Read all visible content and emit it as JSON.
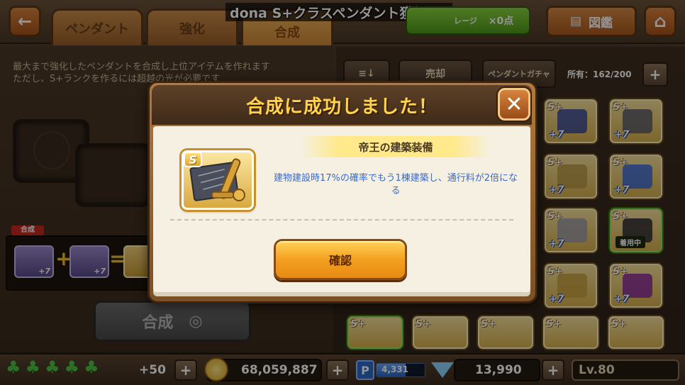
{
  "top_bar": {
    "back_icon": "back-arrow-icon",
    "tabs": [
      {
        "label": "ペンダント"
      },
      {
        "label": "強化"
      },
      {
        "label": "合成"
      }
    ],
    "ticker_text": "dona S+クラスペンダント獲得おめ",
    "points_label_fragment": "レージ",
    "points_value": "×0点",
    "zukan_label": "図鑑",
    "zukan_icon": "book-icon",
    "home_icon": "home-icon"
  },
  "left_panel": {
    "description_line1": "最大まで強化したペンダントを合成し上位アイテムを作れます",
    "description_line2": "ただし、S+ランクを作るには超越の光が必要です",
    "combo_tag": "合成",
    "plus7": "+7",
    "plus_sign": "+",
    "equals_sign": "=",
    "gousei_button": "合成"
  },
  "right_panel": {
    "sort_icon": "sort-icon",
    "sell_button": "売却",
    "gacha_button": "ペンダントガチャ",
    "owned_text": "所有：162/200",
    "plus": "+",
    "card_rank": "S+",
    "card_plus": "+7",
    "equipped_label": "着用中"
  },
  "bottom_bar": {
    "clover_icon": "clover-icon",
    "clover_extra": "+50",
    "coins": "68,059,887",
    "p_label": "P",
    "p_value": "4,331",
    "p_fill": 0.6,
    "gems": "13,990",
    "level": "Lv.80",
    "plus": "+"
  },
  "dialog": {
    "title": "合成に成功しました！",
    "close_icon": "close-x-icon",
    "item_rank": "S",
    "item_name": "帝王の建築装備",
    "item_description": "建物建設時17%の確率でもう1棟建築し、通行料が2倍になる",
    "confirm_button": "確認"
  },
  "colors": {
    "title_gold": "#ffd34a",
    "desc_blue": "#3a6ac8",
    "confirm_orange": "#f4a020"
  }
}
